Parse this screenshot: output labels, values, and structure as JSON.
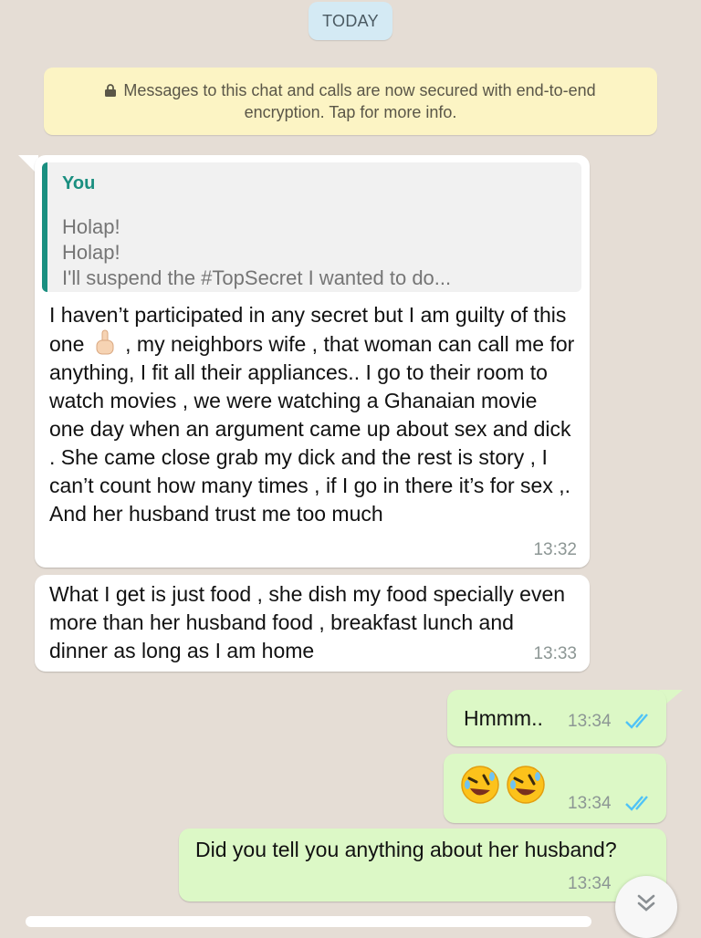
{
  "date_chip": "TODAY",
  "encryption_notice": {
    "text": "Messages to this chat and calls are now secured with end-to-end encryption. Tap for more info.",
    "icon": "lock-icon"
  },
  "messages": [
    {
      "direction": "incoming",
      "quote": {
        "author": "You",
        "lines": [
          "Holap!",
          "Holap!",
          "I'll suspend the #TopSecret I wanted to do..."
        ]
      },
      "text_before_emoji": "I haven’t participated in any secret but I am guilty of this one",
      "emoji": "index-pointing-up-emoji",
      "text_after_emoji": ", my neighbors wife , that woman can call me for anything, I fit all their appliances.. I go to their room to watch movies , we were watching a Ghanaian movie one day when an argument came up about sex and dick . She came close grab my dick and the rest is story , I can’t count how many times , if I go in there it’s for sex ,. And her husband trust me too much",
      "time": "13:32"
    },
    {
      "direction": "incoming",
      "text": "What I get is just food , she dish my food specially even more than her husband food , breakfast lunch and dinner as long as I am home",
      "time": "13:33"
    },
    {
      "direction": "outgoing",
      "text": "Hmmm..",
      "time": "13:34",
      "status": "read-double-check-icon"
    },
    {
      "direction": "outgoing",
      "emojis": [
        "rolling-on-floor-laughing-emoji",
        "rolling-on-floor-laughing-emoji"
      ],
      "time": "13:34",
      "status": "read-double-check-icon"
    },
    {
      "direction": "outgoing",
      "text": "Did you tell you anything about her husband?",
      "time": "13:34",
      "status": "read-double-check-icon"
    }
  ],
  "scroll_button_icon": "double-chevron-down-icon",
  "colors": {
    "chat_background": "#e5ddd5",
    "incoming_bubble": "#ffffff",
    "outgoing_bubble": "#dcf8c6",
    "read_ticks": "#4fc3f7",
    "quote_accent": "#1a8f80",
    "encryption_notice_bg": "#fcf4c4",
    "date_chip_bg": "#d4eaf4"
  }
}
